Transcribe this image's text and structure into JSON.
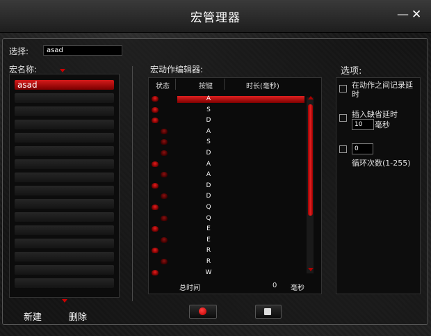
{
  "window": {
    "title": "宏管理器",
    "minimize_icon": "minimize-icon",
    "close_icon": "close-icon",
    "minimize_glyph": "—",
    "close_glyph": "✕"
  },
  "select": {
    "label": "选择:",
    "value": "asad"
  },
  "macros": {
    "label": "宏名称:",
    "items": [
      "asad"
    ]
  },
  "editor": {
    "label": "宏动作编辑器:",
    "columns": {
      "status": "状态",
      "key": "按键",
      "duration": "时长(毫秒)"
    },
    "rows": [
      {
        "status": "up",
        "key": "A"
      },
      {
        "status": "up",
        "key": "S"
      },
      {
        "status": "up",
        "key": "D"
      },
      {
        "status": "down",
        "key": "A"
      },
      {
        "status": "down",
        "key": "S"
      },
      {
        "status": "down",
        "key": "D"
      },
      {
        "status": "up",
        "key": "A"
      },
      {
        "status": "down",
        "key": "A"
      },
      {
        "status": "up",
        "key": "D"
      },
      {
        "status": "down",
        "key": "D"
      },
      {
        "status": "up",
        "key": "Q"
      },
      {
        "status": "down",
        "key": "Q"
      },
      {
        "status": "up",
        "key": "E"
      },
      {
        "status": "down",
        "key": "E"
      },
      {
        "status": "up",
        "key": "R"
      },
      {
        "status": "down",
        "key": "R"
      },
      {
        "status": "up",
        "key": "W"
      }
    ],
    "total_label": "总时间",
    "total_value": "0",
    "total_unit": "毫秒"
  },
  "options": {
    "label": "选项:",
    "record_delay": "在动作之间记录延时",
    "insert_default_delay": "插入缺省延时",
    "default_delay_value": "10",
    "default_delay_unit": "毫秒",
    "loop_value": "0",
    "loop_label": "循环次数(1-255)"
  },
  "buttons": {
    "new": "新建",
    "delete": "删除"
  },
  "colors": {
    "accent": "#d61a1a",
    "background": "#161616"
  }
}
